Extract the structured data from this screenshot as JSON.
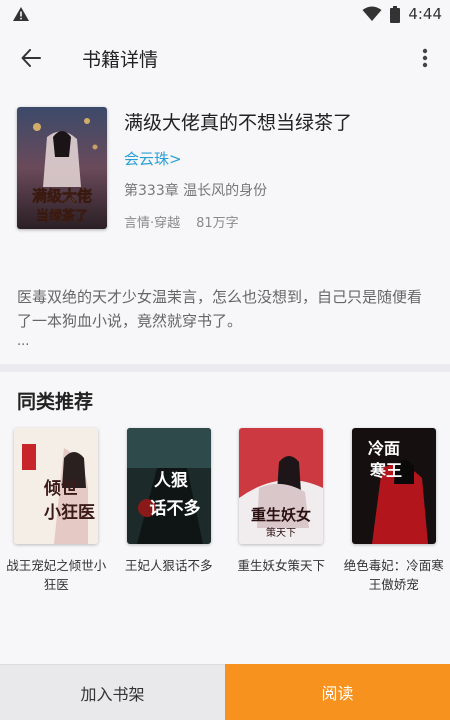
{
  "status_bar": {
    "time": "4:44"
  },
  "app_bar": {
    "title": "书籍详情"
  },
  "book": {
    "title": "满级大佬真的不想当绿茶了",
    "author": "会云珠>",
    "chapter": "第333章 温长风的身份",
    "category": "言情·穿越",
    "word_count": "81万字",
    "cover_text": "满级大佬当绿茶了"
  },
  "description": {
    "text": "医毒双绝的天才少女温茉言，怎么也没想到，自己只是随便看了一本狗血小说，竟然就穿书了。",
    "more": "..."
  },
  "recommend": {
    "title": "同类推荐",
    "items": [
      {
        "name": "战王宠妃之倾世小狂医",
        "cover_text": "倾世小狂医"
      },
      {
        "name": "王妃人狠话不多",
        "cover_text": "人狠话不多"
      },
      {
        "name": "重生妖女策天下",
        "cover_text": "重生妖女"
      },
      {
        "name": "绝色毒妃：冷面寒王傲娇宠",
        "cover_text": "冷面寒王"
      }
    ]
  },
  "bottom": {
    "add_shelf": "加入书架",
    "read": "阅读"
  }
}
